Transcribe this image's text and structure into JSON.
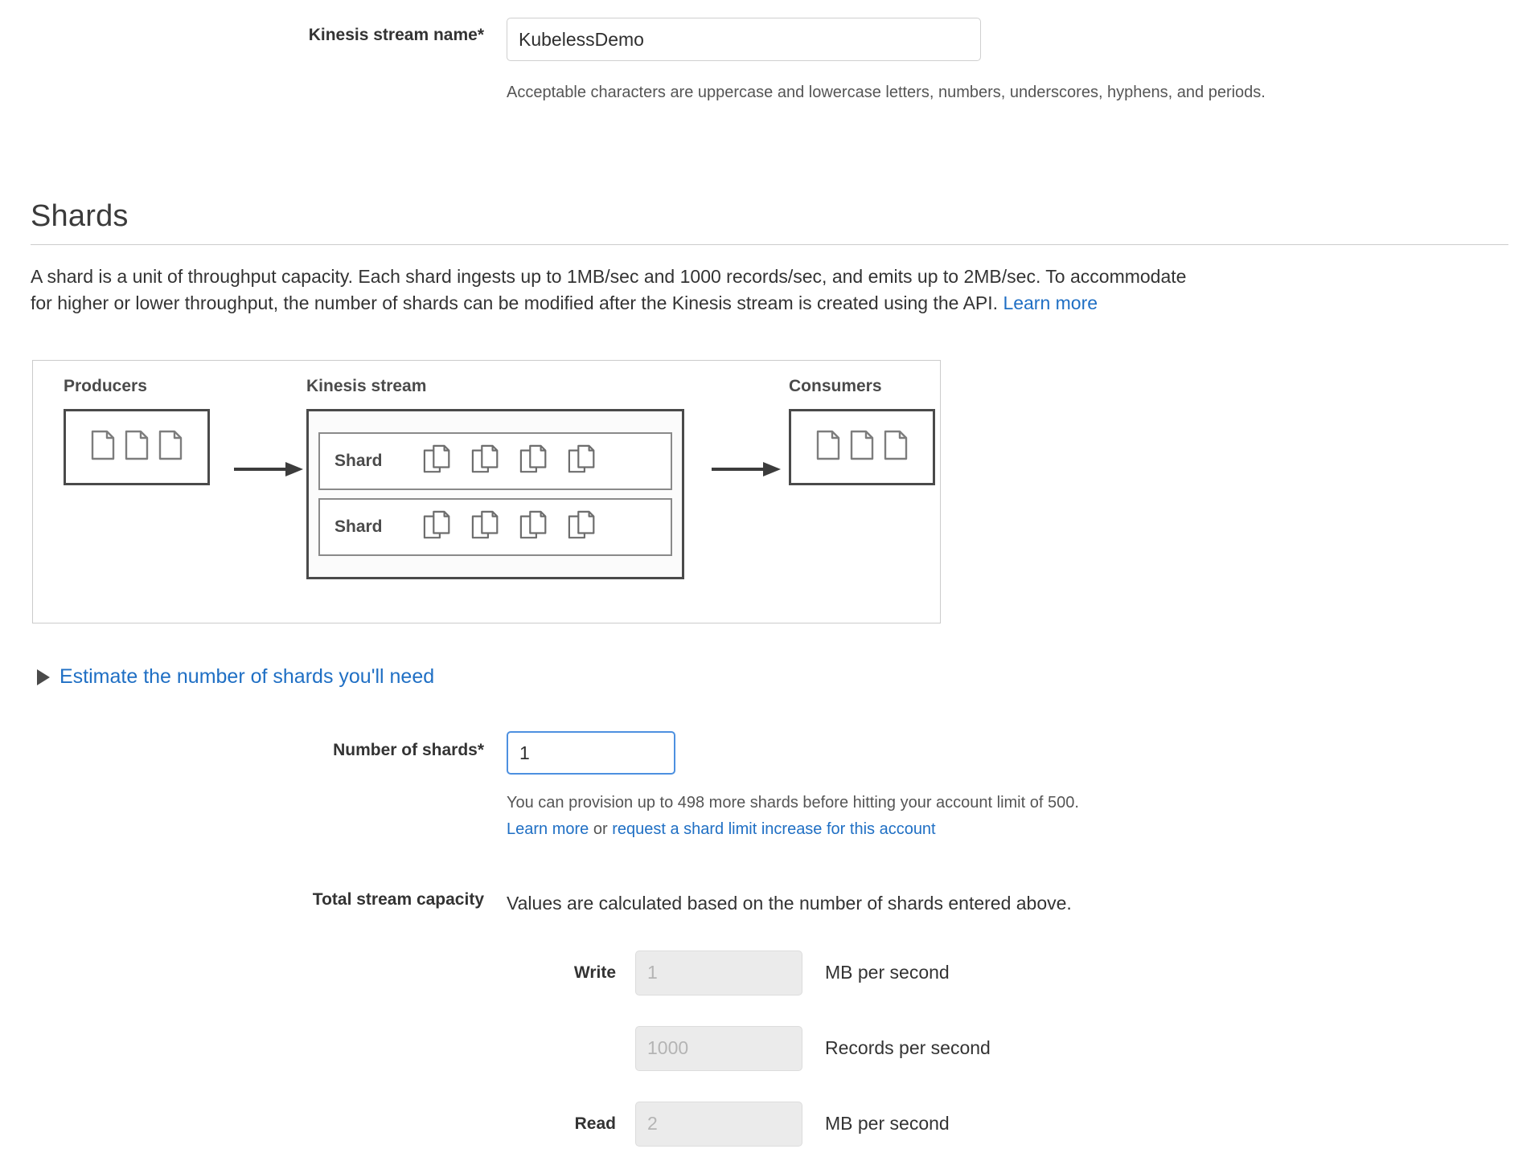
{
  "stream_name_field": {
    "label": "Kinesis stream name*",
    "value": "KubelessDemo",
    "placeholder": "",
    "helper": "Acceptable characters are uppercase and lowercase letters, numbers, underscores, hyphens, and periods."
  },
  "shards_section": {
    "title": "Shards",
    "description_line1": "A shard is a unit of throughput capacity. Each shard ingests up to 1MB/sec and 1000 records/sec, and emits up to 2MB/sec. To accommodate",
    "description_line2": "for higher or lower throughput, the number of shards can be modified after the Kinesis stream is created using the API.",
    "description_link": "Learn more"
  },
  "diagram": {
    "producers_label": "Producers",
    "stream_label": "Kinesis stream",
    "consumers_label": "Consumers",
    "shard_rows": [
      {
        "label": "Shard",
        "record_count": 4
      },
      {
        "label": "Shard",
        "record_count": 4
      }
    ],
    "producer_doc_count": 3,
    "consumer_doc_count": 3,
    "icons": {
      "document": "document-icon",
      "records": "stacked-records-icon",
      "flow": "right-arrow-icon"
    }
  },
  "estimate_disclosure": {
    "label": "Estimate the number of shards you'll need",
    "expanded": false,
    "icon": "triangle-right-icon"
  },
  "number_of_shards_field": {
    "label": "Number of shards*",
    "value": "1",
    "focused": true,
    "helper": "You can provision up to 498 more shards before hitting your account limit of 500.",
    "link_learn_more": "Learn more",
    "link_separator": "or",
    "link_request_increase": "request a shard limit increase for this account"
  },
  "total_stream_capacity": {
    "label": "Total stream capacity",
    "description": "Values are calculated based on the number of shards entered above.",
    "rows": [
      {
        "label": "Write",
        "value": "1",
        "unit": "MB per second"
      },
      {
        "label": "",
        "value": "1000",
        "unit": "Records per second"
      },
      {
        "label": "Read",
        "value": "2",
        "unit": "MB per second"
      }
    ]
  },
  "colors": {
    "link": "#1f6fc4",
    "focus_border": "#4d90e0",
    "text": "#333333",
    "muted": "#555555",
    "disabled_bg": "#ebebeb",
    "diagram_stroke": "#4a4a4a"
  }
}
